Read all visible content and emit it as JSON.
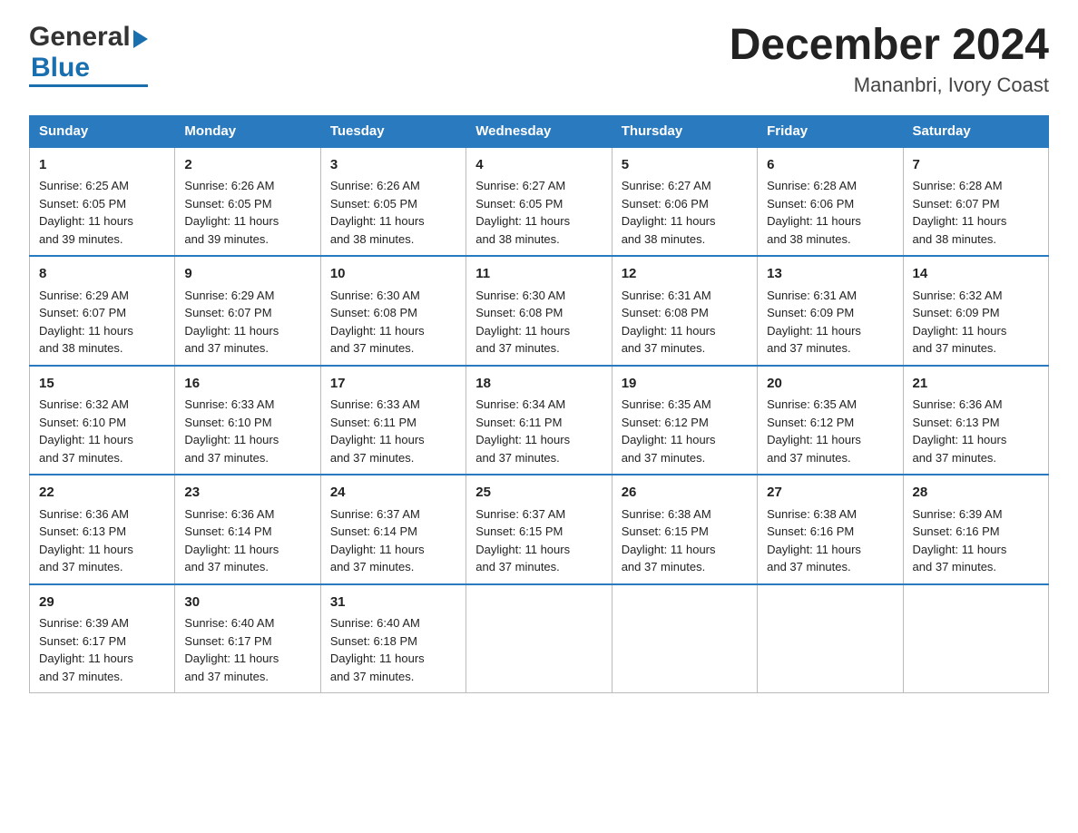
{
  "logo": {
    "general": "General",
    "blue": "Blue"
  },
  "title": "December 2024",
  "subtitle": "Mananbri, Ivory Coast",
  "weekdays": [
    "Sunday",
    "Monday",
    "Tuesday",
    "Wednesday",
    "Thursday",
    "Friday",
    "Saturday"
  ],
  "weeks": [
    [
      {
        "day": "1",
        "sunrise": "6:25 AM",
        "sunset": "6:05 PM",
        "daylight": "11 hours and 39 minutes."
      },
      {
        "day": "2",
        "sunrise": "6:26 AM",
        "sunset": "6:05 PM",
        "daylight": "11 hours and 39 minutes."
      },
      {
        "day": "3",
        "sunrise": "6:26 AM",
        "sunset": "6:05 PM",
        "daylight": "11 hours and 38 minutes."
      },
      {
        "day": "4",
        "sunrise": "6:27 AM",
        "sunset": "6:05 PM",
        "daylight": "11 hours and 38 minutes."
      },
      {
        "day": "5",
        "sunrise": "6:27 AM",
        "sunset": "6:06 PM",
        "daylight": "11 hours and 38 minutes."
      },
      {
        "day": "6",
        "sunrise": "6:28 AM",
        "sunset": "6:06 PM",
        "daylight": "11 hours and 38 minutes."
      },
      {
        "day": "7",
        "sunrise": "6:28 AM",
        "sunset": "6:07 PM",
        "daylight": "11 hours and 38 minutes."
      }
    ],
    [
      {
        "day": "8",
        "sunrise": "6:29 AM",
        "sunset": "6:07 PM",
        "daylight": "11 hours and 38 minutes."
      },
      {
        "day": "9",
        "sunrise": "6:29 AM",
        "sunset": "6:07 PM",
        "daylight": "11 hours and 37 minutes."
      },
      {
        "day": "10",
        "sunrise": "6:30 AM",
        "sunset": "6:08 PM",
        "daylight": "11 hours and 37 minutes."
      },
      {
        "day": "11",
        "sunrise": "6:30 AM",
        "sunset": "6:08 PM",
        "daylight": "11 hours and 37 minutes."
      },
      {
        "day": "12",
        "sunrise": "6:31 AM",
        "sunset": "6:08 PM",
        "daylight": "11 hours and 37 minutes."
      },
      {
        "day": "13",
        "sunrise": "6:31 AM",
        "sunset": "6:09 PM",
        "daylight": "11 hours and 37 minutes."
      },
      {
        "day": "14",
        "sunrise": "6:32 AM",
        "sunset": "6:09 PM",
        "daylight": "11 hours and 37 minutes."
      }
    ],
    [
      {
        "day": "15",
        "sunrise": "6:32 AM",
        "sunset": "6:10 PM",
        "daylight": "11 hours and 37 minutes."
      },
      {
        "day": "16",
        "sunrise": "6:33 AM",
        "sunset": "6:10 PM",
        "daylight": "11 hours and 37 minutes."
      },
      {
        "day": "17",
        "sunrise": "6:33 AM",
        "sunset": "6:11 PM",
        "daylight": "11 hours and 37 minutes."
      },
      {
        "day": "18",
        "sunrise": "6:34 AM",
        "sunset": "6:11 PM",
        "daylight": "11 hours and 37 minutes."
      },
      {
        "day": "19",
        "sunrise": "6:35 AM",
        "sunset": "6:12 PM",
        "daylight": "11 hours and 37 minutes."
      },
      {
        "day": "20",
        "sunrise": "6:35 AM",
        "sunset": "6:12 PM",
        "daylight": "11 hours and 37 minutes."
      },
      {
        "day": "21",
        "sunrise": "6:36 AM",
        "sunset": "6:13 PM",
        "daylight": "11 hours and 37 minutes."
      }
    ],
    [
      {
        "day": "22",
        "sunrise": "6:36 AM",
        "sunset": "6:13 PM",
        "daylight": "11 hours and 37 minutes."
      },
      {
        "day": "23",
        "sunrise": "6:36 AM",
        "sunset": "6:14 PM",
        "daylight": "11 hours and 37 minutes."
      },
      {
        "day": "24",
        "sunrise": "6:37 AM",
        "sunset": "6:14 PM",
        "daylight": "11 hours and 37 minutes."
      },
      {
        "day": "25",
        "sunrise": "6:37 AM",
        "sunset": "6:15 PM",
        "daylight": "11 hours and 37 minutes."
      },
      {
        "day": "26",
        "sunrise": "6:38 AM",
        "sunset": "6:15 PM",
        "daylight": "11 hours and 37 minutes."
      },
      {
        "day": "27",
        "sunrise": "6:38 AM",
        "sunset": "6:16 PM",
        "daylight": "11 hours and 37 minutes."
      },
      {
        "day": "28",
        "sunrise": "6:39 AM",
        "sunset": "6:16 PM",
        "daylight": "11 hours and 37 minutes."
      }
    ],
    [
      {
        "day": "29",
        "sunrise": "6:39 AM",
        "sunset": "6:17 PM",
        "daylight": "11 hours and 37 minutes."
      },
      {
        "day": "30",
        "sunrise": "6:40 AM",
        "sunset": "6:17 PM",
        "daylight": "11 hours and 37 minutes."
      },
      {
        "day": "31",
        "sunrise": "6:40 AM",
        "sunset": "6:18 PM",
        "daylight": "11 hours and 37 minutes."
      },
      null,
      null,
      null,
      null
    ]
  ],
  "labels": {
    "sunrise": "Sunrise:",
    "sunset": "Sunset:",
    "daylight": "Daylight:"
  }
}
